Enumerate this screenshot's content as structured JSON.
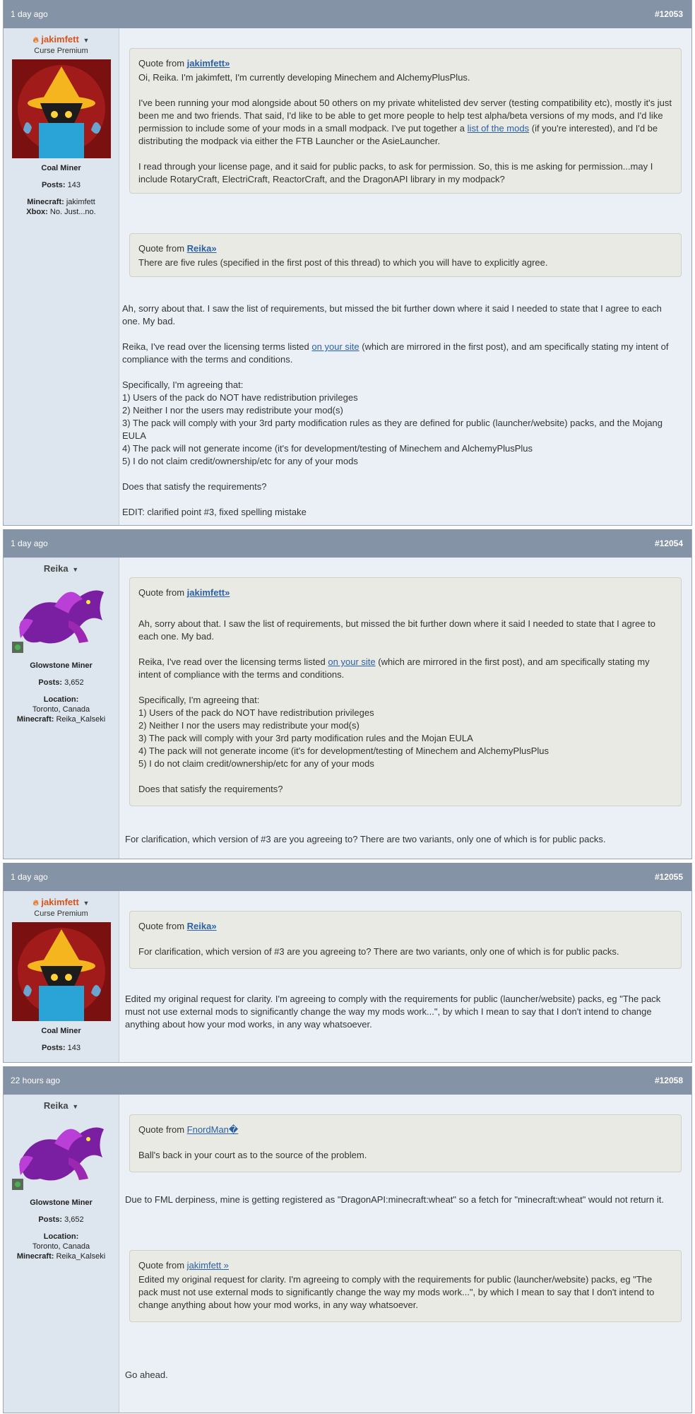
{
  "posts": [
    {
      "time": "1 day ago",
      "number": "#12053",
      "user": {
        "name": "jakimfett",
        "title": "Curse Premium",
        "rank": "Coal Miner",
        "posts_label": "Posts:",
        "posts": "143",
        "extra1_label": "Minecraft:",
        "extra1": "jakimfett",
        "extra2_label": "Xbox:",
        "extra2": "No. Just...no."
      },
      "quote1": {
        "prefix": "Quote from",
        "author": "jakimfett»",
        "p1": "Oi, Reika. I'm jakimfett, I'm currently developing Minechem and AlchemyPlusPlus.",
        "p2a": "I've been running your mod alongside about 50 others on my private whitelisted dev server (testing compatibility etc), mostly it's just been me and two friends. That said, I'd like to be able to get more people to help test alpha/beta versions of my mods, and I'd like permission to include some of your mods in a small modpack. I've put together a",
        "p2link": "list of the mods",
        "p2b": "(if you're interested), and I'd be distributing the modpack via either the FTB Launcher or the AsieLauncher.",
        "p3": "I read through your license page, and it said for public packs, to ask for permission. So, this is me asking for permission...may I include RotaryCraft, ElectriCraft, ReactorCraft, and the DragonAPI library in my modpack?"
      },
      "quote2": {
        "prefix": "Quote from",
        "author": "Reika»",
        "p1": "There are five rules (specified in the first post of this thread) to which you will have to explicitly agree."
      },
      "body": {
        "p1": "Ah, sorry about that. I saw the list of requirements, but missed the bit further down where it said I needed to state that I agree to each one. My bad.",
        "p2a": "Reika, I've read over the licensing terms listed",
        "p2link": "on your site",
        "p2b": "(which are mirrored in the first post), and am specifically stating my intent of compliance with the terms and conditions.",
        "list_intro": "Specifically, I'm agreeing that:",
        "l1": "1) Users of the pack do NOT have redistribution privileges",
        "l2": "2) Neither I nor the users may redistribute your mod(s)",
        "l3": "3) The pack will comply with your 3rd party modification rules as they are defined for public (launcher/website) packs, and the Mojang EULA",
        "l4": "4) The pack will not generate income (it's for development/testing of Minechem and AlchemyPlusPlus",
        "l5": "5) I do not claim credit/ownership/etc for any of your mods",
        "p3": "Does that satisfy the requirements?",
        "p4": "EDIT: clarified point #3, fixed spelling mistake"
      }
    },
    {
      "time": "1 day ago",
      "number": "#12054",
      "user": {
        "name": "Reika",
        "rank": "Glowstone Miner",
        "posts_label": "Posts:",
        "posts": "3,652",
        "loc_label": "Location:",
        "loc": "Toronto, Canada",
        "mc_label": "Minecraft:",
        "mc": "Reika_Kalseki"
      },
      "quote": {
        "prefix": "Quote from",
        "author": "jakimfett»",
        "p1": "Ah, sorry about that. I saw the list of requirements, but missed the bit further down where it said I needed to state that I agree to each one. My bad.",
        "p2a": "Reika, I've read over the licensing terms listed",
        "p2link": "on your site",
        "p2b": "(which are mirrored in the first post), and am specifically stating my intent of compliance with the terms and conditions.",
        "list_intro": "Specifically, I'm agreeing that:",
        "l1": "1) Users of the pack do NOT have redistribution privileges",
        "l2": "2) Neither I nor the users may redistribute your mod(s)",
        "l3": "3) The pack will comply with your 3rd party modification rules and the Mojan EULA",
        "l4": "4) The pack will not generate income (it's for development/testing of Minechem and AlchemyPlusPlus",
        "l5": "5) I do not claim credit/ownership/etc for any of your mods",
        "p3": "Does that satisfy the requirements?"
      },
      "body": "For clarification, which version of #3 are you agreeing to? There are two variants, only one of which is for public packs."
    },
    {
      "time": "1 day ago",
      "number": "#12055",
      "user": {
        "name": "jakimfett",
        "title": "Curse Premium",
        "rank": "Coal Miner",
        "posts_label": "Posts:",
        "posts": "143"
      },
      "quote": {
        "prefix": "Quote from",
        "author": "Reika»",
        "p1": "For clarification, which version of #3 are you agreeing to? There are two variants, only one of which is for public packs."
      },
      "body": "Edited my original request for clarity. I'm agreeing to comply with the requirements for public (launcher/website) packs, eg \"The pack must not use external mods to significantly change the way my mods work...\", by which I mean to say that I don't intend to change anything about how your mod works, in any way whatsoever."
    },
    {
      "time": "22 hours ago",
      "number": "#12058",
      "user": {
        "name": "Reika",
        "rank": "Glowstone Miner",
        "posts_label": "Posts:",
        "posts": "3,652",
        "loc_label": "Location:",
        "loc": "Toronto, Canada",
        "mc_label": "Minecraft:",
        "mc": "Reika_Kalseki"
      },
      "quote1": {
        "prefix": "Quote from",
        "author": "FnordMan�",
        "p1": "Ball's back in your court as to the source of the problem."
      },
      "body1": "Due to FML derpiness, mine is getting registered as \"DragonAPI:minecraft:wheat\" so a fetch for \"minecraft:wheat\" would not return it.",
      "quote2": {
        "prefix": "Quote from",
        "author": "jakimfett »",
        "p1": "Edited my original request for clarity. I'm agreeing to comply with the requirements for public (launcher/website) packs, eg \"The pack must not use external mods to significantly change the way my mods work...\", by which I mean to say that I don't intend to change anything about how your mod works, in any way whatsoever."
      },
      "body2": "Go ahead."
    }
  ],
  "colors": {
    "header": "#8593a6",
    "sidebar": "#dde5ee",
    "content": "#ebf0f7",
    "quote": "#e9eae4",
    "link": "#2b60a8",
    "premium": "#d9531e"
  },
  "icons": [
    "user-menu-caret-icon",
    "flame-icon",
    "online-status-icon"
  ]
}
